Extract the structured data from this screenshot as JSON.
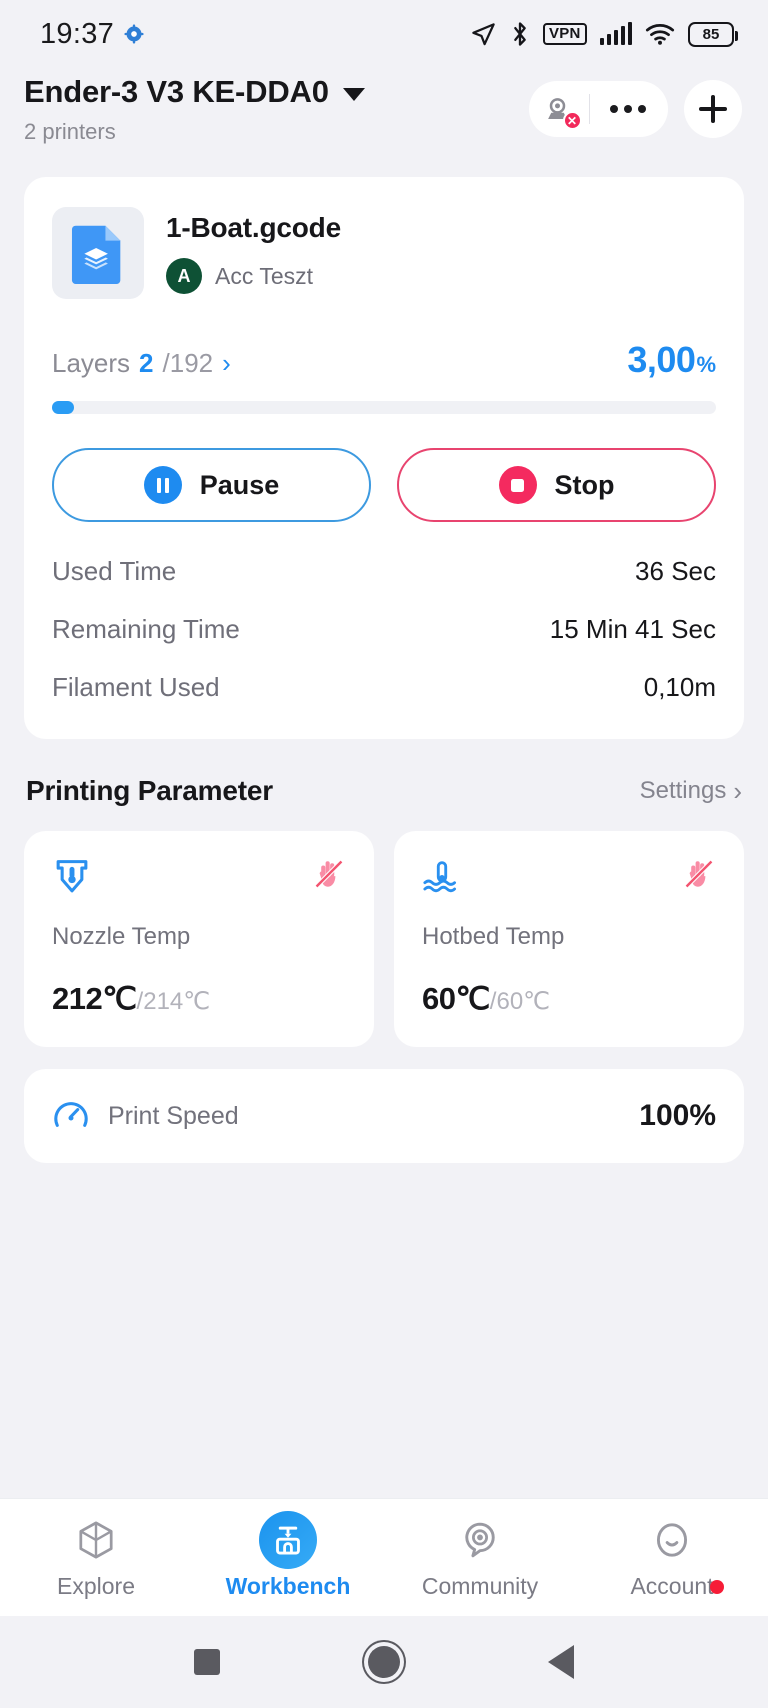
{
  "status_bar": {
    "time": "19:37",
    "gear_icon": "gear-icon",
    "location_icon": "location-arrow-icon",
    "bluetooth_icon": "bluetooth-icon",
    "vpn_label": "VPN",
    "signal_icon": "cellular-signal-icon",
    "wifi_icon": "wifi-icon",
    "battery_level": "85"
  },
  "header": {
    "printer_name": "Ender-3 V3 KE-DDA0",
    "printer_count": "2 printers",
    "camera_icon": "camera-off-icon",
    "more_icon": "more-options-icon",
    "add_icon": "plus-icon"
  },
  "job": {
    "file_icon": "gcode-file-icon",
    "file_name": "1-Boat.gcode",
    "owner_initial": "A",
    "owner_name": "Acc Teszt",
    "layers_label": "Layers",
    "layers_current": "2",
    "layers_total": "/192",
    "layers_chevron": "chevron-right-icon",
    "progress_value": "3,00",
    "progress_symbol": "%",
    "progress_percent": 3.0,
    "pause_label": "Pause",
    "pause_icon": "pause-icon",
    "stop_label": "Stop",
    "stop_icon": "stop-icon",
    "stats": [
      {
        "label": "Used Time",
        "value": "36 Sec"
      },
      {
        "label": "Remaining Time",
        "value": "15 Min  41 Sec"
      },
      {
        "label": "Filament Used",
        "value": "0,10m"
      }
    ]
  },
  "printing_parameter": {
    "title": "Printing Parameter",
    "settings_label": "Settings",
    "settings_chevron": "chevron-right-icon",
    "nozzle": {
      "icon": "nozzle-temperature-icon",
      "warning_icon": "do-not-touch-hot-icon",
      "label": "Nozzle Temp",
      "current": "212℃",
      "target": "/214℃"
    },
    "hotbed": {
      "icon": "hotbed-temperature-icon",
      "warning_icon": "do-not-touch-hot-icon",
      "label": "Hotbed Temp",
      "current": "60℃",
      "target": "/60℃"
    },
    "print_speed": {
      "icon": "speedometer-icon",
      "label": "Print Speed",
      "value": "100%"
    }
  },
  "tabbar": {
    "items": [
      {
        "label": "Explore",
        "icon": "cube-icon",
        "active": false
      },
      {
        "label": "Workbench",
        "icon": "printer-icon",
        "active": true
      },
      {
        "label": "Community",
        "icon": "location-pin-icon",
        "active": false
      },
      {
        "label": "Account",
        "icon": "smiley-face-icon",
        "active": false
      }
    ]
  },
  "system_nav": {
    "recent_icon": "square-recents-icon",
    "home_icon": "circle-home-icon",
    "back_icon": "triangle-back-icon"
  },
  "colors": {
    "accent_blue": "#1e8bf0",
    "danger_red": "#f42a5f",
    "page_bg": "#f2f2f6",
    "card_bg": "#ffffff"
  }
}
